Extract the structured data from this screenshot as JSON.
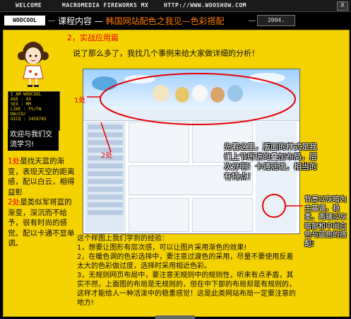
{
  "topbar": {
    "welcome": "WELCOME",
    "product": "MACROMEDIA FIREWORKS MX",
    "url": "HTTP://WWW.WOOSHOW.COM",
    "close": "X"
  },
  "titlebar": {
    "logo": "WOOCOOL",
    "title_prefix": "课程内容 —",
    "title_highlight": "韩国网站配色之我见—色彩搭配",
    "date": "2004."
  },
  "panel": {
    "section_heading": "2，实战应用篇",
    "intro": "说了那么多了，我找几个事例来给大家做详细的分析！",
    "profile": {
      "lines": [
        "I AM WOOCOOL",
        "AGE : XX",
        "SEX : MM",
        "LIKE : PS/FW",
        "DW/CD/",
        "OICQ : 2450785"
      ],
      "welcome": "欢迎与我们交流学习!"
    },
    "left_note": {
      "tag1": "1处",
      "text1": "是找天蓝的渐变，表现天空的距离感，配以白云，相得益彰",
      "tag2": "2处",
      "text2": "是类似军将蓝的渐变，深沉而不给予，很有时尚的感觉。配以卡通不显单调。"
    },
    "callout1": "1处",
    "callout2": "2处",
    "overlay_note": "先看这里，版面的样式是我们上节所讲的叠加布局，层次分明！卡通活泼，相当的有特点！",
    "right_note": "背景以灰暗为主基调，稳重，再辅以灰暗部和中间白色与蓝色的搭配!",
    "lessons": {
      "title": "这个样图上我们学到的经验：",
      "items": [
        "1，想要让图形有层次感，可以让图片采用渐色的效果!",
        "2，在暖色调的色彩选择中，要注意过渡色的采用，尽量不要使用反差太大的色彩做过度，选择时采用相近色彩。",
        "3，无规则网页布局中，要注意无规则中的规则性，听来有点矛盾，其实不然，上面图的布局是无规则的，但在中下部的布局却是有规则的，这样才能给人一种活泼中的稳重感觉！这是此类网站布局一定要注意的地方!"
      ]
    }
  },
  "colors": {
    "panel_bg": "#f4d200",
    "accent_red": "#e60000",
    "accent_orange": "#ff7a00"
  }
}
